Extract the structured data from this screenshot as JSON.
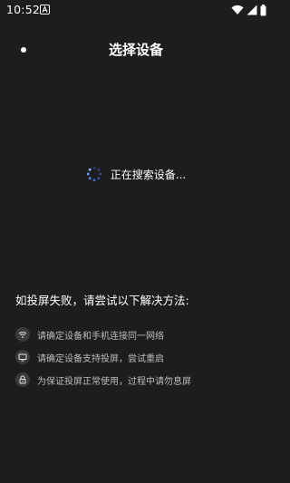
{
  "status_bar": {
    "time": "10:52",
    "icons": [
      "notification-a-icon",
      "wifi-icon",
      "signal-icon",
      "battery-icon"
    ]
  },
  "header": {
    "title": "选择设备",
    "back_icon": "back-dot-icon"
  },
  "search": {
    "status_text": "正在搜索设备...",
    "spinner_icon": "loading-spinner-icon",
    "accent_color": "#4a7cf0"
  },
  "help": {
    "title": "如投屏失败，请尝试以下解决方法:",
    "tips": [
      {
        "icon": "wifi-icon",
        "text": "请确定设备和手机连接同一网络"
      },
      {
        "icon": "monitor-icon",
        "text": "请确定设备支持投屏，尝试重启"
      },
      {
        "icon": "lock-icon",
        "text": "为保证投屏正常使用，过程中请勿息屏"
      }
    ]
  },
  "colors": {
    "background": "#1d1d1d",
    "text_primary": "#ffffff",
    "text_secondary": "#bdbdbd",
    "icon_bg": "#3a3a3a"
  }
}
